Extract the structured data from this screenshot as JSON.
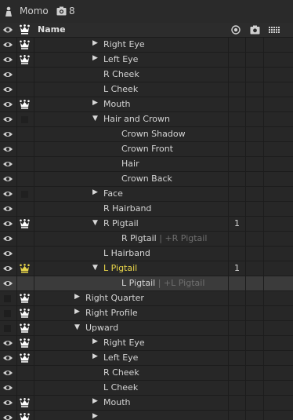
{
  "topbar": {
    "title": "Momo",
    "count": "8"
  },
  "header": {
    "name": "Name"
  },
  "colors": {
    "active_text": "#e9d64a",
    "selected_row": "#3b3b3b",
    "background": "#262626"
  },
  "rows": [
    {
      "label": "Right Eye",
      "suffix": "",
      "depth": 3,
      "arrow": "right",
      "eye": true,
      "crown": "white",
      "value": ""
    },
    {
      "label": "Left Eye",
      "suffix": "",
      "depth": 3,
      "arrow": "right",
      "eye": true,
      "crown": "white",
      "value": ""
    },
    {
      "label": "R Cheek",
      "suffix": "",
      "depth": 3,
      "arrow": "",
      "eye": true,
      "crown": "",
      "value": ""
    },
    {
      "label": "L Cheek",
      "suffix": "",
      "depth": 3,
      "arrow": "",
      "eye": true,
      "crown": "",
      "value": ""
    },
    {
      "label": "Mouth",
      "suffix": "",
      "depth": 3,
      "arrow": "right",
      "eye": true,
      "crown": "white",
      "value": ""
    },
    {
      "label": "Hair and Crown",
      "suffix": "",
      "depth": 3,
      "arrow": "down",
      "eye": true,
      "crown": "box",
      "value": ""
    },
    {
      "label": "Crown Shadow",
      "suffix": "",
      "depth": 4,
      "arrow": "",
      "eye": true,
      "crown": "",
      "value": ""
    },
    {
      "label": "Crown Front",
      "suffix": "",
      "depth": 4,
      "arrow": "",
      "eye": true,
      "crown": "",
      "value": ""
    },
    {
      "label": "Hair",
      "suffix": "",
      "depth": 4,
      "arrow": "",
      "eye": true,
      "crown": "",
      "value": ""
    },
    {
      "label": "Crown Back",
      "suffix": "",
      "depth": 4,
      "arrow": "",
      "eye": true,
      "crown": "",
      "value": ""
    },
    {
      "label": "Face",
      "suffix": "",
      "depth": 3,
      "arrow": "right",
      "eye": true,
      "crown": "box",
      "value": ""
    },
    {
      "label": "R Hairband",
      "suffix": "",
      "depth": 3,
      "arrow": "",
      "eye": true,
      "crown": "",
      "value": ""
    },
    {
      "label": "R Pigtail",
      "suffix": "",
      "depth": 3,
      "arrow": "down",
      "eye": true,
      "crown": "white",
      "value": "1"
    },
    {
      "label": "R Pigtail",
      "suffix": "| +R Pigtail",
      "depth": 4,
      "arrow": "",
      "eye": true,
      "crown": "",
      "value": ""
    },
    {
      "label": "L Hairband",
      "suffix": "",
      "depth": 3,
      "arrow": "",
      "eye": true,
      "crown": "",
      "value": ""
    },
    {
      "label": "L Pigtail",
      "suffix": "",
      "depth": 3,
      "arrow": "down",
      "eye": true,
      "crown": "yellow",
      "value": "1",
      "active": true
    },
    {
      "label": "L Pigtail",
      "suffix": "| +L Pigtail",
      "depth": 4,
      "arrow": "",
      "eye": true,
      "crown": "",
      "value": "",
      "selected": true
    },
    {
      "label": "Right Quarter",
      "suffix": "",
      "depth": 2,
      "arrow": "right",
      "eye": false,
      "crown": "white",
      "value": ""
    },
    {
      "label": "Right Profile",
      "suffix": "",
      "depth": 2,
      "arrow": "right",
      "eye": false,
      "crown": "white",
      "value": ""
    },
    {
      "label": "Upward",
      "suffix": "",
      "depth": 2,
      "arrow": "down",
      "eye": false,
      "crown": "white",
      "value": ""
    },
    {
      "label": "Right Eye",
      "suffix": "",
      "depth": 3,
      "arrow": "right",
      "eye": true,
      "crown": "white",
      "value": ""
    },
    {
      "label": "Left Eye",
      "suffix": "",
      "depth": 3,
      "arrow": "right",
      "eye": true,
      "crown": "white",
      "value": ""
    },
    {
      "label": "R Cheek",
      "suffix": "",
      "depth": 3,
      "arrow": "",
      "eye": true,
      "crown": "",
      "value": ""
    },
    {
      "label": "L Cheek",
      "suffix": "",
      "depth": 3,
      "arrow": "",
      "eye": true,
      "crown": "",
      "value": ""
    },
    {
      "label": "Mouth",
      "suffix": "",
      "depth": 3,
      "arrow": "right",
      "eye": true,
      "crown": "white",
      "value": ""
    },
    {
      "label": "",
      "suffix": "",
      "depth": 3,
      "arrow": "right",
      "eye": true,
      "crown": "white",
      "value": ""
    }
  ]
}
